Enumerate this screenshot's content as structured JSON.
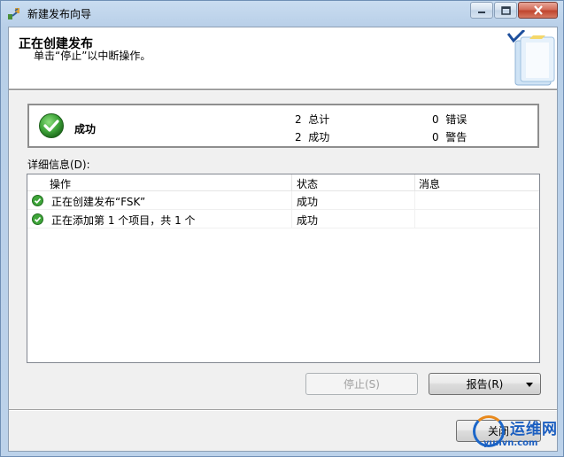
{
  "window": {
    "title": "新建发布向导",
    "minimize_icon": "minimize-icon",
    "maximize_icon": "maximize-icon",
    "close_icon": "close-icon"
  },
  "header": {
    "title": "正在创建发布",
    "subtitle": "单击“停止”以中断操作。",
    "art_icon": "wizard-book-icon"
  },
  "summary": {
    "status": "成功",
    "stats": [
      {
        "count": "2",
        "label": "总计"
      },
      {
        "count": "2",
        "label": "成功"
      },
      {
        "count": "0",
        "label": "错误"
      },
      {
        "count": "0",
        "label": "警告"
      }
    ]
  },
  "details": {
    "label": "详细信息(D):",
    "columns": [
      "操作",
      "状态",
      "消息"
    ],
    "rows": [
      {
        "action": "正在创建发布“FSK”",
        "status": "成功",
        "message": ""
      },
      {
        "action": "正在添加第 1 个项目，共 1 个",
        "status": "成功",
        "message": ""
      }
    ]
  },
  "buttons": {
    "stop": "停止(S)",
    "report": "报告(R)",
    "close": "关闭"
  },
  "watermark": {
    "name": "运维网",
    "url": "yunvn.com"
  },
  "colors": {
    "success_green": "#3fa53a",
    "title_bar": "#c9dcf0",
    "close_button": "#c0452e"
  }
}
